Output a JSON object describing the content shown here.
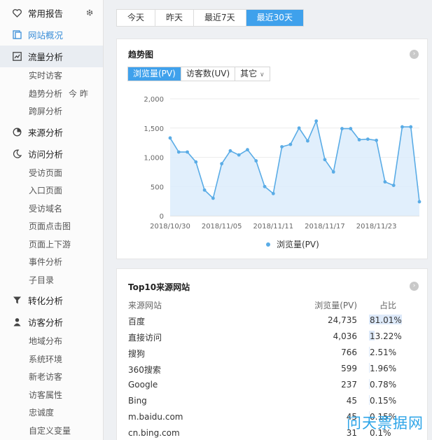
{
  "sidebar": {
    "favorites": "常用报告",
    "overview": "网站概况",
    "traffic": {
      "label": "流量分析",
      "items": [
        "实时访客",
        "趋势分析",
        "跨屏分析"
      ],
      "trend_extra": "今 昨"
    },
    "source": {
      "label": "来源分析"
    },
    "visit": {
      "label": "访问分析",
      "items": [
        "受访页面",
        "入口页面",
        "受访域名",
        "页面点击图",
        "页面上下游",
        "事件分析",
        "子目录"
      ]
    },
    "conversion": {
      "label": "转化分析"
    },
    "visitor": {
      "label": "访客分析",
      "items": [
        "地域分布",
        "系统环境",
        "新老访客",
        "访客属性",
        "忠诚度",
        "自定义变量"
      ]
    }
  },
  "date_tabs": [
    "今天",
    "昨天",
    "最近7天",
    "最近30天"
  ],
  "active_date_tab": 3,
  "trend": {
    "title": "趋势图",
    "metric_tabs": [
      "浏览量(PV)",
      "访客数(UV)",
      "其它"
    ],
    "legend": "浏览量(PV)"
  },
  "chart_data": {
    "type": "area",
    "title": "",
    "series": [
      {
        "name": "浏览量(PV)",
        "values": [
          1330,
          1090,
          1090,
          920,
          440,
          300,
          890,
          1110,
          1040,
          1130,
          940,
          500,
          380,
          1180,
          1220,
          1500,
          1280,
          1620,
          960,
          750,
          1490,
          1490,
          1300,
          1310,
          1290,
          580,
          520,
          1520,
          1520,
          240
        ]
      }
    ],
    "x": [
      "2018/10/30",
      "2018/10/31",
      "2018/11/01",
      "2018/11/02",
      "2018/11/03",
      "2018/11/04",
      "2018/11/05",
      "2018/11/06",
      "2018/11/07",
      "2018/11/08",
      "2018/11/09",
      "2018/11/10",
      "2018/11/11",
      "2018/11/12",
      "2018/11/13",
      "2018/11/14",
      "2018/11/15",
      "2018/11/16",
      "2018/11/17",
      "2018/11/18",
      "2018/11/19",
      "2018/11/20",
      "2018/11/21",
      "2018/11/22",
      "2018/11/23",
      "2018/11/24",
      "2018/11/25",
      "2018/11/26",
      "2018/11/27",
      "2018/11/28"
    ],
    "x_tick_labels": [
      "2018/10/30",
      "2018/11/05",
      "2018/11/11",
      "2018/11/17",
      "2018/11/23"
    ],
    "x_tick_indices": [
      0,
      6,
      12,
      18,
      24
    ],
    "y_ticks": [
      "0",
      "500",
      "1,000",
      "1,500",
      "2,000"
    ],
    "ylim": [
      0,
      2000
    ],
    "grid": true,
    "legend_position": "bottom",
    "colors": {
      "line": "#5aace6",
      "fill": "#dcecfb"
    }
  },
  "top10": {
    "title": "Top10来源网站",
    "headers": {
      "name": "来源网站",
      "pv": "浏览量(PV)",
      "pct": "占比"
    },
    "rows": [
      {
        "name": "百度",
        "pv": "24,735",
        "pct": "81.01%",
        "share": 81.01
      },
      {
        "name": "直接访问",
        "pv": "4,036",
        "pct": "13.22%",
        "share": 13.22
      },
      {
        "name": "搜狗",
        "pv": "766",
        "pct": "2.51%",
        "share": 2.51
      },
      {
        "name": "360搜索",
        "pv": "599",
        "pct": "1.96%",
        "share": 1.96
      },
      {
        "name": "Google",
        "pv": "237",
        "pct": "0.78%",
        "share": 0.78
      },
      {
        "name": "Bing",
        "pv": "45",
        "pct": "0.15%",
        "share": 0.15
      },
      {
        "name": "m.baidu.com",
        "pv": "45",
        "pct": "0.15%",
        "share": 0.15
      },
      {
        "name": "cn.bing.com",
        "pv": "31",
        "pct": "0.1%",
        "share": 0.1
      }
    ]
  },
  "watermark": "问天票据网"
}
